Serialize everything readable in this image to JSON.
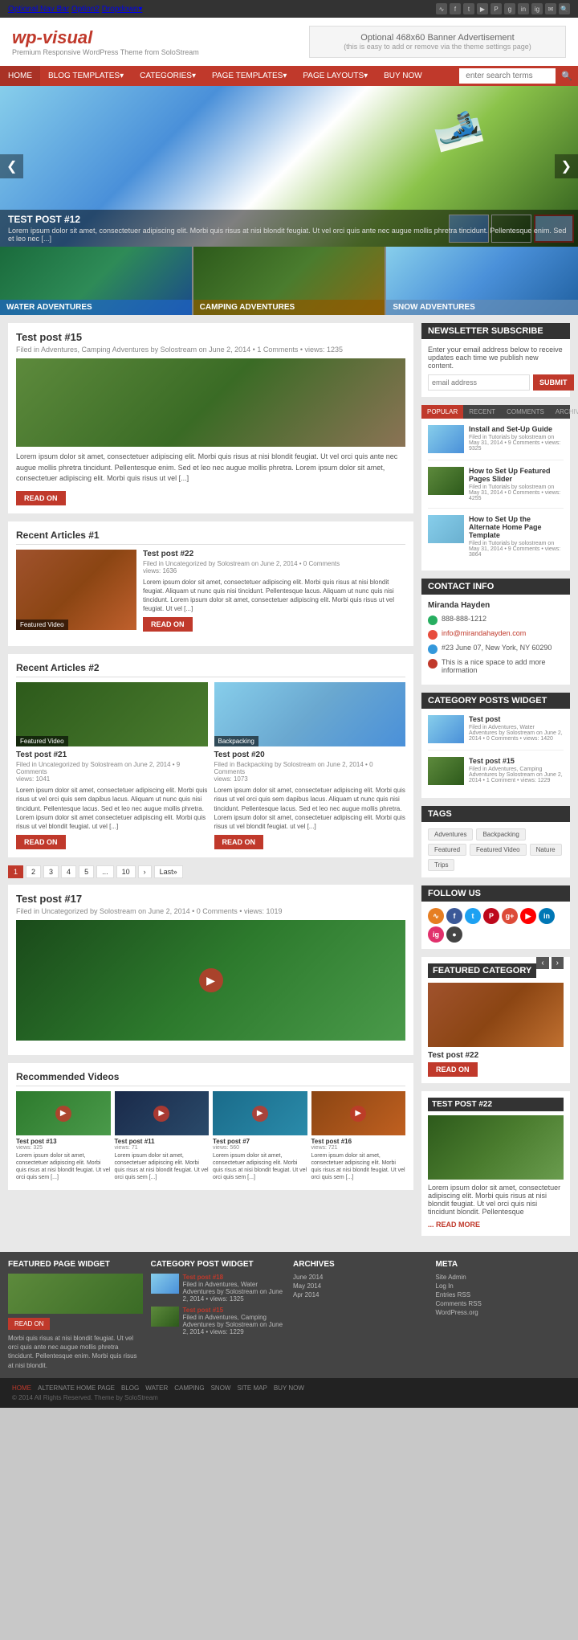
{
  "topnav": {
    "links": [
      "Optional Nav Bar",
      "Option2",
      "Dropdown▾"
    ],
    "icons": [
      "rss",
      "fb",
      "tw",
      "gp",
      "pin",
      "yt",
      "li",
      "in",
      "mail",
      "search"
    ]
  },
  "header": {
    "logo_text": "wp-visual",
    "logo_sub": "Premium Responsive WordPress Theme from SoloStream",
    "banner_title": "Optional 468x60 Banner Advertisement",
    "banner_sub": "(this is easy to add or remove via the theme settings page)"
  },
  "mainnav": {
    "items": [
      "HOME",
      "BLOG TEMPLATES▾",
      "CATEGORIES▾",
      "PAGE TEMPLATES▾",
      "PAGE LAYOUTS▾",
      "BUY NOW"
    ],
    "search_placeholder": "enter search terms"
  },
  "slider": {
    "post_title": "TEST POST #12",
    "post_desc": "Lorem ipsum dolor sit amet, consectetuer adipiscing elit. Morbi quis risus at nisi blondit feugiat. Ut vel orci quis ante nec augue mollis phretra tincidunt. Pellentesque enim. Sed et leo nec [...]"
  },
  "categories": {
    "items": [
      {
        "label": "WATER ADVENTURES",
        "color": "#1a6b8a"
      },
      {
        "label": "CAMPING ADVENTURES",
        "color": "#8B6914"
      },
      {
        "label": "SNOW ADVENTURES",
        "color": "#4a7aaa"
      }
    ]
  },
  "post15": {
    "title": "Test post #15",
    "meta": "Filed in Adventures, Camping Adventures by Solostream on June 2, 2014 • 1 Comments • views: 1235",
    "text": "Lorem ipsum dolor sit amet, consectetuer adipiscing elit. Morbi quis risus at nisi blondit feugiat. Ut vel orci quis ante nec augue mollis phretra tincidunt. Pellentesque enim. Sed et leo nec augue mollis phretra. Lorem ipsum dolor sit amet, consectetuer adipiscing elit. Morbi quis risus ut vel [...]",
    "read_on": "READ ON"
  },
  "recent1": {
    "section_title": "Recent Articles #1",
    "article": {
      "title": "Test post #22",
      "meta": "Filed in Uncategorized by Solostream on June 2, 2014 • 0 Comments",
      "views": "views: 1636",
      "text": "Lorem ipsum dolor sit amet, consectetuer adipiscing elit. Morbi quis risus at nisi blondit feugiat. Aliquam ut nunc quis nisi tincidunt. Pellentesque lacus. Aliquam ut nunc quis nisi tincidunt. Lorem ipsum dolor sit amet, consectetuer adipiscing elit. Morbi quis risus ut vel feugiat. Ut vel [...]",
      "read_on": "READ ON",
      "thumb_label": "Featured Video"
    }
  },
  "recent2": {
    "section_title": "Recent Articles #2",
    "articles": [
      {
        "title": "Test post #21",
        "meta": "Filed in Uncategorized by Solostream on June 2, 2014 • 9 Comments",
        "views": "views: 1041",
        "text": "Lorem ipsum dolor sit amet, consectetuer adipiscing elit. Morbi quis risus ut vel orci quis sem dapibus lacus. Aliquam ut nunc quis nisi tincidunt. Pellentesque lacus. Sed et leo nec augue mollis phretra. Lorem ipsum dolor sit amet consectetuer adipiscing elit. Morbi quis risus ut vel blondit feugiat. ut vel [...]",
        "read_on": "READ ON",
        "thumb_label": "Featured Video"
      },
      {
        "title": "Test post #20",
        "meta": "Filed in Backpacking by Solostream on June 2, 2014 • 0 Comments",
        "views": "views: 1073",
        "text": "Lorem ipsum dolor sit amet, consectetuer adipiscing elit. Morbi quis risus ut vel orci quis sem dapibus lacus. Aliquam ut nunc quis nisi tincidunt. Pellentesque lacus. Sed et leo nec augue mollis phretra. Lorem ipsum dolor sit amet, consectetuer adipiscing elit. Morbi quis risus ut vel blondit feugiat. ut vel [...]",
        "read_on": "READ ON",
        "thumb_label": "Backpacking"
      }
    ]
  },
  "pagination": {
    "items": [
      "1",
      "2",
      "3",
      "4",
      "5",
      "...",
      "10",
      "›",
      "Last»"
    ]
  },
  "post17": {
    "title": "Test post #17",
    "meta": "Filed in Uncategorized by Solostream on June 2, 2014 • 0 Comments • views: 1019"
  },
  "recommended": {
    "section_title": "Recommended Videos",
    "videos": [
      {
        "title": "Test post #13",
        "views": "views: 325",
        "text": "Lorem ipsum dolor sit amet, consectetuer adipiscing elit. Morbi quis risus at nisi blondit feugiat. Ut vel orci quis sem [...]"
      },
      {
        "title": "Test post #11",
        "views": "views: 71",
        "text": "Lorem ipsum dolor sit amet, consectetuer adipiscing elit. Morbi quis risus at nisi blondit feugiat. Ut vel orci quis sem [...]"
      },
      {
        "title": "Test post #7",
        "views": "views: 560",
        "text": "Lorem ipsum dolor sit amet, consectetuer adipiscing elit. Morbi quis risus at nisi blondit feugiat. Ut vel orci quis sem [...]"
      },
      {
        "title": "Test post #16",
        "views": "views: 721",
        "text": "Lorem ipsum dolor sit amet, consectetuer adipiscing elit. Morbi quis risus at nisi blondit feugiat. Ut vel orci quis sem [...]"
      }
    ]
  },
  "sidebar": {
    "newsletter": {
      "title": "NEWSLETTER SUBSCRIBE",
      "desc": "Enter your email address below to receive updates each time we publish new content.",
      "input_placeholder": "email address",
      "submit_label": "SUBMIT"
    },
    "popular_tabs": [
      "POPULAR",
      "RECENT",
      "COMMENTS",
      "ARCHIVES"
    ],
    "popular_posts": [
      {
        "title": "Install and Set-Up Guide",
        "meta": "Filed in Tutorials by solostream on May 31, 2014 • 9 Comments • views: 9325"
      },
      {
        "title": "How to Set Up Featured Pages Slider",
        "meta": "Filed in Tutorials by solostream on May 31, 2014 • 0 Comments • views: 4255"
      },
      {
        "title": "How to Set Up the Alternate Home Page Template",
        "meta": "Filed in Tutorials by solostream on May 31, 2014 • 9 Comments • views: 3864"
      }
    ],
    "contact": {
      "title": "CONTACT INFO",
      "name": "Miranda Hayden",
      "phone": "888-888-1212",
      "email": "info@mirandahayden.com",
      "address": "#23 June 07, New York, NY 60290",
      "note": "This is a nice space to add more information"
    },
    "category_widget": {
      "title": "CATEGORY POSTS WIDGET",
      "posts": [
        {
          "title": "Test post",
          "meta": "Filed in Adventures, Water Adventures by Solostream on June 2, 2014 • 0 Comments • views: 1420"
        },
        {
          "title": "Test post #15",
          "meta": "Filed in Adventures, Camping Adventures by Solostream on June 2, 2014 • 1 Comment • views: 1229"
        }
      ]
    },
    "tags": {
      "title": "TAGS",
      "items": [
        "Adventures",
        "Backpacking",
        "Featured",
        "Featured Video",
        "Nature",
        "Trips"
      ]
    },
    "follow": {
      "title": "FOLLOW US"
    },
    "featured_cat": {
      "title": "FEATURED CATEGORY",
      "post_title": "Test post #22",
      "read_on": "READ ON"
    },
    "test22_widget": {
      "title": "TEST POST #22",
      "text": "Lorem ipsum dolor sit amet, consectetuer adipiscing elit. Morbi quis risus at nisi blondit feugiat. Ut vel orci quis nisi tincidunt blondit. Pellentesque",
      "more_link": "... READ MORE"
    }
  },
  "footer_widgets": {
    "featured_page": {
      "title": "FEATURED PAGE WIDGET",
      "read_on": "READ ON",
      "text": "Morbi quis risus at nisi blondit feugiat. Ut vel orci quis ante nec augue mollis phretra tincidunt. Pellentesque enim. Morbi quis risus at nisi blondit."
    },
    "category_post": {
      "title": "CATEGORY POST WIDGET",
      "posts": [
        {
          "title": "Test post #18",
          "meta": "Filed in Adventures, Water Adventures by Solostream on June 2, 2014 • views: 1325"
        },
        {
          "title": "Test post #15",
          "meta": "Filed in Adventures, Camping Adventures by Solostream on June 2, 2014 • views: 1229"
        }
      ]
    },
    "archives": {
      "title": "ARCHIVES",
      "items": [
        "June 2014",
        "May 2014",
        "Apr 2014"
      ]
    },
    "meta": {
      "title": "META",
      "items": [
        "Site Admin",
        "Log In",
        "Entries RSS",
        "Comments RSS",
        "WordPress.org"
      ]
    }
  },
  "bottom_footer": {
    "nav": [
      "HOME",
      "ALTERNATE HOME PAGE",
      "BLOG",
      "WATER",
      "CAMPING",
      "SNOW",
      "SITE MAP",
      "BUY NOW"
    ],
    "copy": "© 2014 All Rights Reserved. Theme by SoloStream"
  }
}
